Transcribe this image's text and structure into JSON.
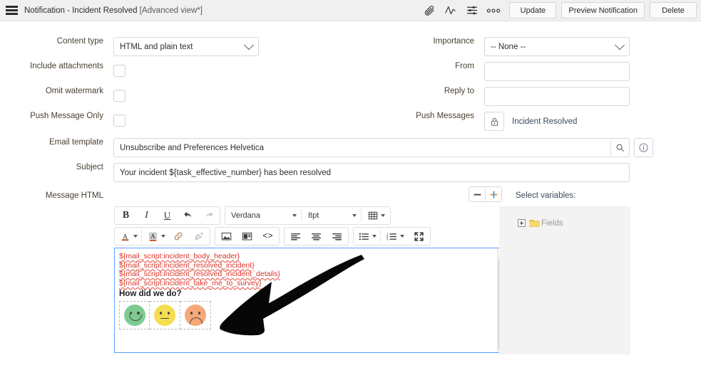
{
  "header": {
    "menu_icon": "hamburger-icon",
    "title": "Notification - Incident Resolved",
    "view_mode": "[Advanced view*]",
    "icons": [
      {
        "name": "attachment-icon",
        "glyph": "attachment"
      },
      {
        "name": "activity-stream-icon",
        "glyph": "pulse"
      },
      {
        "name": "filter-settings-icon",
        "glyph": "sliders"
      },
      {
        "name": "more-options-icon",
        "glyph": "ooo"
      }
    ],
    "buttons": [
      {
        "name": "update-button",
        "label": "Update"
      },
      {
        "name": "preview-notification-button",
        "label": "Preview Notification"
      },
      {
        "name": "delete-button",
        "label": "Delete"
      }
    ]
  },
  "form": {
    "content_type": {
      "label": "Content type",
      "value": "HTML and plain text"
    },
    "include_attachments": {
      "label": "Include attachments",
      "checked": false
    },
    "omit_watermark": {
      "label": "Omit watermark",
      "checked": false
    },
    "push_message_only": {
      "label": "Push Message Only",
      "checked": false
    },
    "importance": {
      "label": "Importance",
      "value": "-- None --"
    },
    "from": {
      "label": "From",
      "value": "",
      "placeholder": ""
    },
    "reply_to": {
      "label": "Reply to",
      "value": "",
      "placeholder": ""
    },
    "push_messages": {
      "label": "Push Messages",
      "lock_icon": "lock-icon",
      "value": "Incident Resolved"
    },
    "email_template": {
      "label": "Email template",
      "value": "Unsubscribe and Preferences Helvetica",
      "search_icon": "search-icon",
      "info_icon": "info-icon"
    },
    "subject": {
      "label": "Subject",
      "value": "Your incident ${task_effective_number} has been resolved"
    },
    "message_html": {
      "label": "Message HTML"
    }
  },
  "zoom_controls": {
    "minus_label": "−",
    "plus_label": "+"
  },
  "editor": {
    "toolbar_row1": {
      "bold": "B",
      "italic": "I",
      "underline": "U",
      "undo": "undo-icon",
      "redo": "redo-icon",
      "font_family": "Verdana",
      "font_size": "8pt",
      "table": "table-icon"
    },
    "toolbar_row2": {
      "text_color": "text-color-icon",
      "highlight_color": "highlight-color-icon",
      "link": "link-icon",
      "unlink": "unlink-icon",
      "image": "image-icon",
      "media": "media-icon",
      "source_code": "<>",
      "align_left": "align-left-icon",
      "align_center": "align-center-icon",
      "align_right": "align-right-icon",
      "bullet_list": "bullet-list-icon",
      "numbered_list": "numbered-list-icon",
      "fullscreen": "fullscreen-icon"
    },
    "content": {
      "lines": [
        "${mail_script:incident_body_header}",
        "${mail_script:incident_resolved_incident}",
        "${mail_script:incident_resolved_incident_details}",
        "${mail_script:incident_take_me_to_survey}"
      ],
      "heading": "How did we do?",
      "faces": [
        {
          "name": "happy-face",
          "color": "#7ecb92",
          "mouth": "smile"
        },
        {
          "name": "neutral-face",
          "color": "#f5dd52",
          "mouth": "flat"
        },
        {
          "name": "sad-face",
          "color": "#f5a878",
          "mouth": "frown"
        }
      ]
    }
  },
  "variables": {
    "label": "Select variables:",
    "tree": [
      {
        "name": "tree-node-fields",
        "label": "Fields",
        "expanded": false,
        "icon": "folder-icon"
      }
    ]
  },
  "annotation": {
    "arrow": "black-curved-arrow"
  },
  "colors": {
    "header_bg": "#f0f0f0",
    "label_text": "#4a4033",
    "field_border": "#d8d8d8",
    "editor_focus_border": "#5b9dff",
    "script_text": "#d9362b",
    "panel_bg": "#f3f3f3"
  }
}
